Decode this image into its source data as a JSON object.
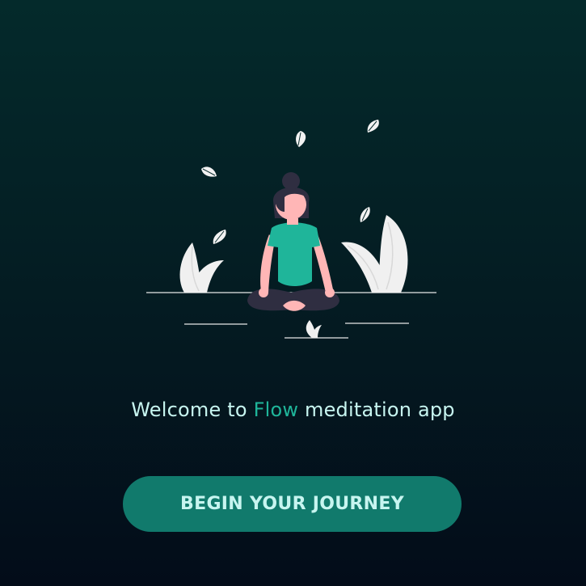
{
  "welcome": {
    "prefix": "Welcome to ",
    "brand": "Flow",
    "suffix": " meditation app"
  },
  "cta": {
    "label": "BEGIN YOUR JOURNEY"
  },
  "colors": {
    "accent": "#1fb59a",
    "button": "#117a6c",
    "text": "#c7f5f0",
    "background_top": "#042a2b",
    "background_bottom": "#030c19"
  },
  "illustration": {
    "icon": "meditating-person-icon"
  }
}
